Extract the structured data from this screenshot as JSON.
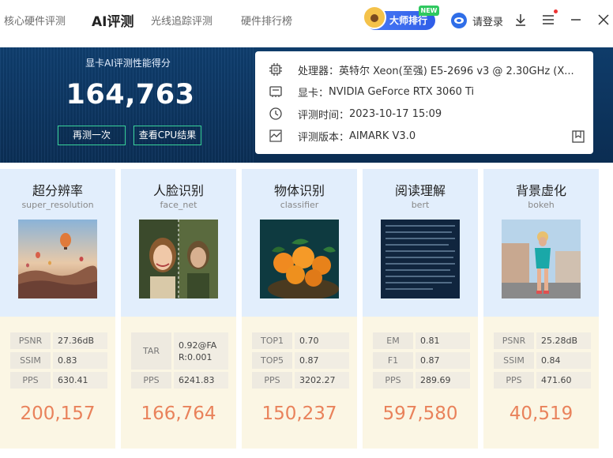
{
  "nav": {
    "tabs": [
      "核心硬件评测",
      "AI评测",
      "光线追踪评测",
      "硬件排行榜"
    ],
    "master_label": "大师排行",
    "new_badge": "NEW",
    "login_label": "请登录"
  },
  "hero": {
    "title": "显卡AI评测性能得分",
    "score": "164,763",
    "retest_label": "再测一次",
    "cpu_result_label": "查看CPU结果"
  },
  "info": {
    "cpu_label": "处理器：",
    "cpu_value": "英特尔 Xeon(至强) E5-2696 v3 @ 2.30GHz (X...",
    "gpu_label": "显卡：",
    "gpu_value": "NVIDIA GeForce RTX 3060 Ti",
    "time_label": "评测时间：",
    "time_value": "2023-10-17 15:09",
    "version_label": "评测版本：",
    "version_value": "AIMARK V3.0"
  },
  "cards": [
    {
      "name": "超分辨率",
      "sub": "super_resolution",
      "metrics": [
        [
          "PSNR",
          "27.36dB"
        ],
        [
          "SSIM",
          "0.83"
        ],
        [
          "PPS",
          "630.41"
        ]
      ],
      "score": "200,157"
    },
    {
      "name": "人脸识别",
      "sub": "face_net",
      "metrics": [
        [
          "TAR",
          "0.92@FAR:0.001"
        ],
        [
          "PPS",
          "6241.83"
        ]
      ],
      "score": "166,764"
    },
    {
      "name": "物体识别",
      "sub": "classifier",
      "metrics": [
        [
          "TOP1",
          "0.70"
        ],
        [
          "TOP5",
          "0.87"
        ],
        [
          "PPS",
          "3202.27"
        ]
      ],
      "score": "150,237"
    },
    {
      "name": "阅读理解",
      "sub": "bert",
      "metrics": [
        [
          "EM",
          "0.81"
        ],
        [
          "F1",
          "0.87"
        ],
        [
          "PPS",
          "289.69"
        ]
      ],
      "score": "597,580"
    },
    {
      "name": "背景虚化",
      "sub": "bokeh",
      "metrics": [
        [
          "PSNR",
          "25.28dB"
        ],
        [
          "SSIM",
          "0.84"
        ],
        [
          "PPS",
          "471.60"
        ]
      ],
      "score": "40,519"
    }
  ],
  "colors": {
    "accent": "#2f5de8",
    "hero_bg": "#0f3c6a",
    "score_orange": "#e9825b",
    "card_top": "#e2eefc",
    "card_bottom": "#fbf6e4"
  }
}
